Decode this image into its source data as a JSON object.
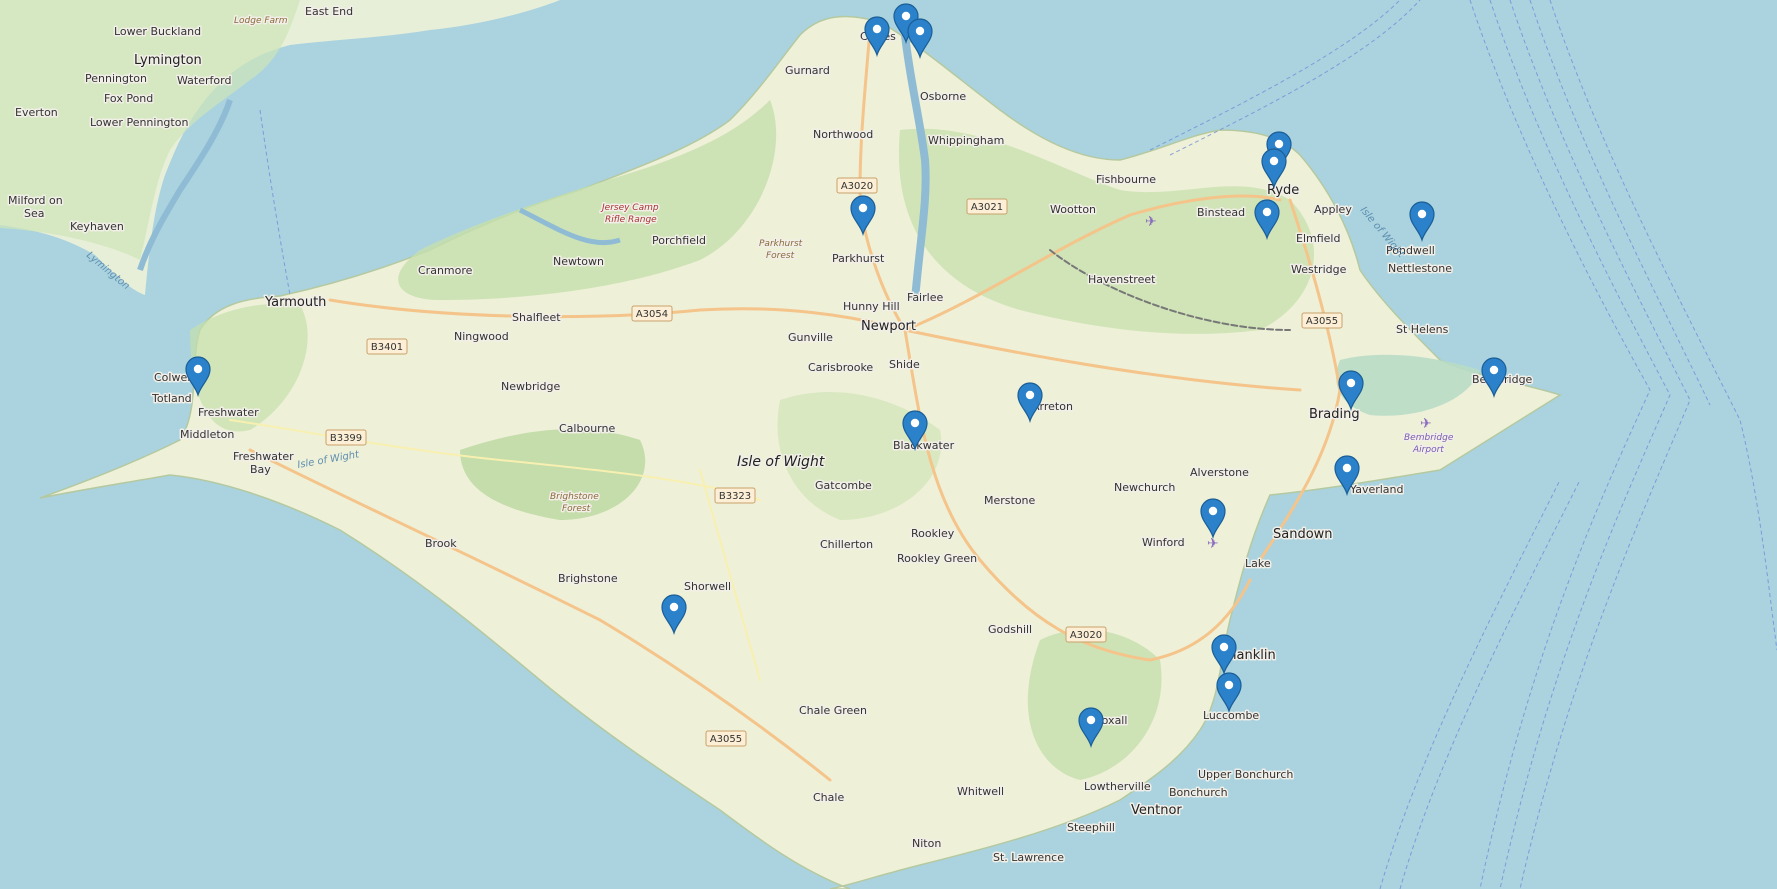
{
  "map": {
    "region_label": "Isle of Wight",
    "marker_color": "#2b82cb",
    "marker_stroke": "#1b5e96",
    "water_color": "#aad3df",
    "land_color": "#f2efe9",
    "green_color": "#c8e4b0",
    "labels": {
      "lower_buckland": "Lower Buckland",
      "lodge_farm": "Lodge Farm",
      "east_end": "East End",
      "lymington": "Lymington",
      "pennington": "Pennington",
      "waterford": "Waterford",
      "everton": "Everton",
      "fox_pond": "Fox Pond",
      "lower_pennington": "Lower Pennington",
      "milford_on": "Milford on",
      "sea": "Sea",
      "keyhaven": "Keyhaven",
      "cowes": "Cowes",
      "gurnard": "Gurnard",
      "osborne": "Osborne",
      "northwood": "Northwood",
      "whippingham": "Whippingham",
      "jersey_camp": "Jersey Camp",
      "rifle_range": "Rifle Range",
      "porchfield": "Porchfield",
      "parkhurst_forest_1": "Parkhurst",
      "parkhurst_forest_2": "Forest",
      "parkhurst": "Parkhurst",
      "fishbourne": "Fishbourne",
      "wootton": "Wootton",
      "binstead": "Binstead",
      "ryde": "Ryde",
      "appley": "Appley",
      "elmfield": "Elmfield",
      "pondwell": "Pondwell",
      "cranmore": "Cranmore",
      "newtown": "Newtown",
      "yarmouth": "Yarmouth",
      "shalfleet": "Shalfleet",
      "ningwood": "Ningwood",
      "hunny_hill": "Hunny Hill",
      "fairlee": "Fairlee",
      "newport": "Newport",
      "havenstreet": "Havenstreet",
      "westridge": "Westridge",
      "nettlestone": "Nettlestone",
      "st_helens": "St Helens",
      "gunville": "Gunville",
      "carisbrooke": "Carisbrooke",
      "shide": "Shide",
      "colwell": "Colwell",
      "totland": "Totland",
      "freshwater": "Freshwater",
      "middleton": "Middleton",
      "newbridge": "Newbridge",
      "calbourne": "Calbourne",
      "brading": "Brading",
      "bembridge": "Bembridge",
      "bembridge_airport_1": "Bembridge",
      "bembridge_airport_2": "Airport",
      "arreton": "Arreton",
      "blackwater": "Blackwater",
      "freshwater_bay_1": "Freshwater",
      "freshwater_bay_2": "Bay",
      "isle_of_wight_coast": "Isle of Wight",
      "gatcombe": "Gatcombe",
      "merstone": "Merstone",
      "alverstone": "Alverstone",
      "yaverland": "Yaverland",
      "newchurch": "Newchurch",
      "brighstone_forest_1": "Brighstone",
      "brighstone_forest_2": "Forest",
      "sandown": "Sandown",
      "winford": "Winford",
      "brook": "Brook",
      "rookley": "Rookley",
      "chillerton": "Chillerton",
      "rookley_green": "Rookley Green",
      "lake": "Lake",
      "brighstone": "Brighstone",
      "shorwell": "Shorwell",
      "godshill": "Godshill",
      "shanklin": "Shanklin",
      "luccombe": "Luccombe",
      "chale_green": "Chale Green",
      "wroxall": "Wroxall",
      "lowtherville": "Lowtherville",
      "upper_bonchurch": "Upper Bonchurch",
      "bonchurch": "Bonchurch",
      "whitwell": "Whitwell",
      "chale": "Chale",
      "ventnor": "Ventnor",
      "steephill": "Steephill",
      "niton": "Niton",
      "st_lawrence": "St. Lawrence",
      "lymington_water": "Lymington",
      "isle_of_wight_water": "Isle of Wight"
    },
    "roads": {
      "a3020_n": "A3020",
      "a3021": "A3021",
      "a3054": "A3054",
      "b3401": "B3401",
      "a3055_e": "A3055",
      "b3399": "B3399",
      "b3323": "B3323",
      "a3020_s": "A3020",
      "a3055_s": "A3055"
    },
    "markers": [
      {
        "id": "cowes-1",
        "icon": "map-pin-icon"
      },
      {
        "id": "cowes-2",
        "icon": "map-pin-icon"
      },
      {
        "id": "cowes-3",
        "icon": "map-pin-icon"
      },
      {
        "id": "parkhurst",
        "icon": "map-pin-icon"
      },
      {
        "id": "ryde-1",
        "icon": "map-pin-icon"
      },
      {
        "id": "ryde-2",
        "icon": "map-pin-icon"
      },
      {
        "id": "binstead",
        "icon": "map-pin-icon"
      },
      {
        "id": "nettlestone",
        "icon": "map-pin-icon"
      },
      {
        "id": "totland",
        "icon": "map-pin-icon"
      },
      {
        "id": "arreton",
        "icon": "map-pin-icon"
      },
      {
        "id": "blackwater",
        "icon": "map-pin-icon"
      },
      {
        "id": "brading",
        "icon": "map-pin-icon"
      },
      {
        "id": "bembridge",
        "icon": "map-pin-icon"
      },
      {
        "id": "yaverland",
        "icon": "map-pin-icon"
      },
      {
        "id": "winford",
        "icon": "map-pin-icon"
      },
      {
        "id": "shorwell",
        "icon": "map-pin-icon"
      },
      {
        "id": "shanklin-1",
        "icon": "map-pin-icon"
      },
      {
        "id": "shanklin-2",
        "icon": "map-pin-icon"
      },
      {
        "id": "wroxall",
        "icon": "map-pin-icon"
      }
    ]
  }
}
